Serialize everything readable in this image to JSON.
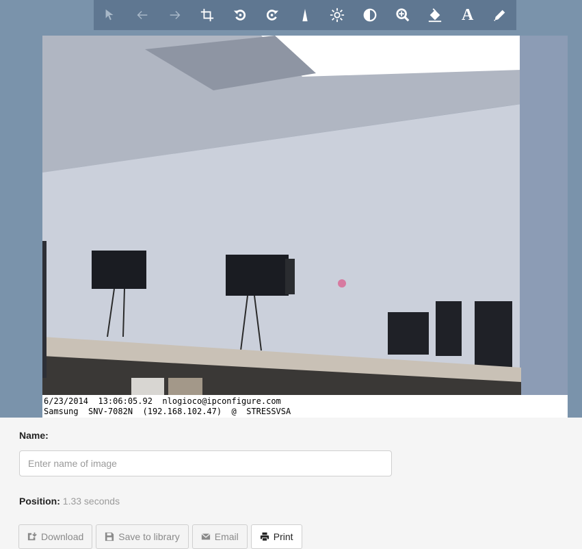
{
  "toolbar": {
    "tools": [
      {
        "icon": "pointer-icon",
        "glyph": "↖",
        "enabled": false
      },
      {
        "icon": "undo-arrow-icon",
        "glyph": "←",
        "enabled": false
      },
      {
        "icon": "redo-arrow-icon",
        "glyph": "→",
        "enabled": false
      },
      {
        "icon": "crop-icon",
        "glyph": "⌗",
        "enabled": true
      },
      {
        "icon": "rotate-left-icon",
        "glyph": "↺",
        "enabled": true
      },
      {
        "icon": "rotate-right-icon",
        "glyph": "↻",
        "enabled": true
      },
      {
        "icon": "sharpen-icon",
        "glyph": "▲",
        "enabled": true
      },
      {
        "icon": "brightness-icon",
        "glyph": "✺",
        "enabled": true
      },
      {
        "icon": "contrast-icon",
        "glyph": "◐",
        "enabled": true
      },
      {
        "icon": "zoom-in-icon",
        "glyph": "⊕",
        "enabled": true
      },
      {
        "icon": "fill-icon",
        "glyph": "◭",
        "enabled": true
      },
      {
        "icon": "text-icon",
        "glyph": "A",
        "enabled": true
      },
      {
        "icon": "pencil-icon",
        "glyph": "✎",
        "enabled": true
      }
    ]
  },
  "image": {
    "caption_line1": "6/23/2014  13:06:05.92  nlogioco@ipconfigure.com",
    "caption_line2": "Samsung  SNV-7082N  (192.168.102.47)  @  STRESSVSA"
  },
  "form": {
    "name_label": "Name:",
    "name_placeholder": "Enter name of image",
    "name_value": "",
    "position_label": "Position:",
    "position_value": "1.33 seconds"
  },
  "actions": {
    "download": "Download",
    "save": "Save to library",
    "email": "Email",
    "print": "Print"
  },
  "colors": {
    "viewer_bg": "#7a93ab",
    "toolbar_bg": "#5f7791"
  }
}
